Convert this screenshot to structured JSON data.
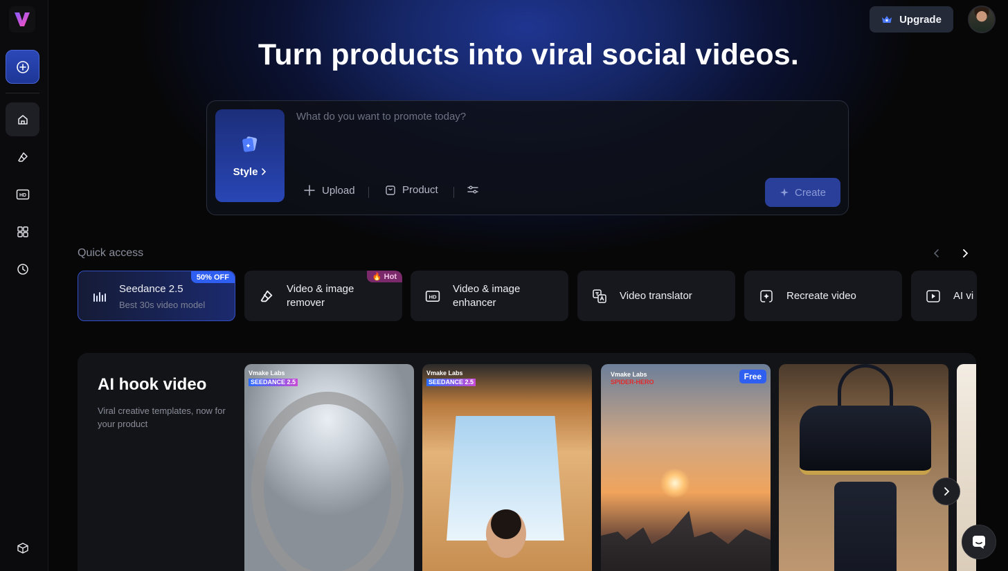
{
  "app": {
    "logo_letter": "V"
  },
  "sidebar": {
    "items": [
      {
        "name": "new",
        "icon": "plus-circle-icon"
      },
      {
        "name": "home",
        "icon": "home-icon"
      },
      {
        "name": "remover",
        "icon": "eraser-icon"
      },
      {
        "name": "enhancer",
        "icon": "hd-icon"
      },
      {
        "name": "apps",
        "icon": "grid-icon"
      },
      {
        "name": "history",
        "icon": "clock-icon"
      },
      {
        "name": "assets",
        "icon": "cube-icon"
      }
    ]
  },
  "header": {
    "upgrade_label": "Upgrade"
  },
  "hero": {
    "title": "Turn products into viral social videos."
  },
  "prompt": {
    "style_label": "Style",
    "placeholder": "What do you want to promote today?",
    "upload_label": "Upload",
    "product_label": "Product",
    "create_label": "Create"
  },
  "quick_access": {
    "title": "Quick access",
    "items": [
      {
        "name": "Seedance 2.5",
        "sub": "Best 30s video model",
        "badge": "50% OFF"
      },
      {
        "name": "Video & image remover",
        "badge": "🔥 Hot"
      },
      {
        "name": "Video & image enhancer"
      },
      {
        "name": "Video translator"
      },
      {
        "name": "Recreate video"
      },
      {
        "name": "AI vi"
      }
    ]
  },
  "hook_section": {
    "title": "AI hook video",
    "description": "Viral creative templates, now for your product",
    "thumbnails": [
      {
        "brand": "Vmake Labs",
        "tag": "SEEDANCE 2.5"
      },
      {
        "brand": "Vmake Labs",
        "tag": "SEEDANCE 2.5"
      },
      {
        "brand": "Vmake Labs",
        "tag": "SPIDER-HERO",
        "badge": "Free"
      },
      {},
      {}
    ]
  },
  "colors": {
    "accent": "#2f5ff0",
    "background": "#070708",
    "card": "#17181d"
  }
}
